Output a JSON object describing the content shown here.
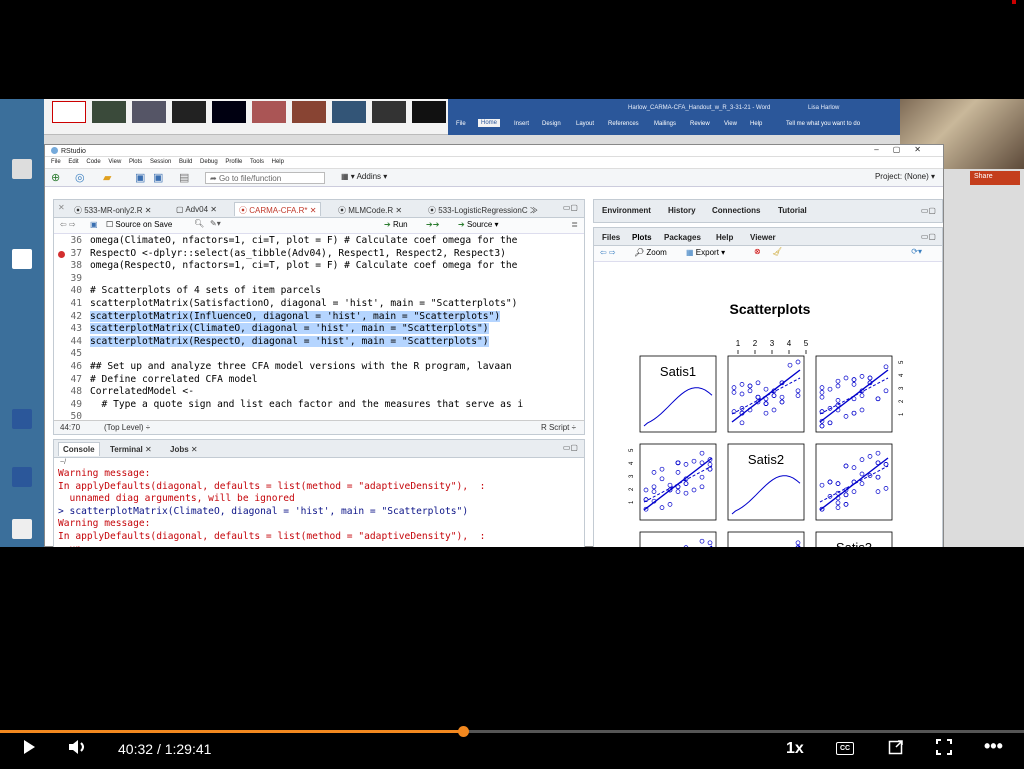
{
  "rstudio": {
    "title": "RStudio",
    "menu": [
      "File",
      "Edit",
      "Code",
      "View",
      "Plots",
      "Session",
      "Build",
      "Debug",
      "Profile",
      "Tools",
      "Help"
    ],
    "goto_placeholder": "Go to file/function",
    "addins_label": "Addins",
    "project_label": "Project: (None)"
  },
  "word": {
    "title": "Harlow_CARMA-CFA_Handout_w_R_3-31-21 - Word",
    "user": "Lisa Harlow",
    "tabs": [
      "File",
      "Home",
      "Insert",
      "Design",
      "Layout",
      "References",
      "Mailings",
      "Review",
      "View",
      "Help",
      "Tell me what you want to do"
    ],
    "share": "Share"
  },
  "source": {
    "tabs": [
      "533-MR-only2.R",
      "Adv04",
      "CARMA-CFA.R*",
      "MLMCode.R",
      "533-LogisticRegressionC"
    ],
    "active_tab": 2,
    "source_on_save": "Source on Save",
    "run_label": "Run",
    "source_label": "Source",
    "lines": [
      {
        "n": "36",
        "text": "omega(ClimateO, nfactors=1, ci=T, plot = F) # Calculate coef omega for the"
      },
      {
        "n": "37",
        "text": "RespectO <-dplyr::select(as_tibble(Adv04), Respect1, Respect2, Respect3)"
      },
      {
        "n": "38",
        "text": "omega(RespectO, nfactors=1, ci=T, plot = F) # Calculate coef omega for the"
      },
      {
        "n": "39",
        "text": ""
      },
      {
        "n": "40",
        "text": "# Scatterplots of 4 sets of item parcels"
      },
      {
        "n": "41",
        "text": "scatterplotMatrix(SatisfactionO, diagonal = 'hist', main = \"Scatterplots\")"
      },
      {
        "n": "42",
        "text": "scatterplotMatrix(InfluenceO, diagonal = 'hist', main = \"Scatterplots\")"
      },
      {
        "n": "43",
        "text": "scatterplotMatrix(ClimateO, diagonal = 'hist', main = \"Scatterplots\")"
      },
      {
        "n": "44",
        "text": "scatterplotMatrix(RespectO, diagonal = 'hist', main = \"Scatterplots\")"
      },
      {
        "n": "45",
        "text": ""
      },
      {
        "n": "46",
        "text": "## Set up and analyze three CFA model versions with the R program, lavaan"
      },
      {
        "n": "47",
        "text": "# Define correlated CFA model"
      },
      {
        "n": "48",
        "text": "CorrelatedModel <-"
      },
      {
        "n": "49",
        "text": "  # Type a quote sign and list each factor and the measures that serve as i"
      },
      {
        "n": "50",
        "text": ""
      }
    ],
    "status_pos": "44:70",
    "status_scope": "(Top Level) ÷",
    "status_type": "R Script ÷"
  },
  "console": {
    "tabs": [
      "Console",
      "Terminal",
      "Jobs"
    ],
    "path": "~/",
    "lines": [
      {
        "kind": "err",
        "text": "Warning message:"
      },
      {
        "kind": "err",
        "text": "In applyDefaults(diagonal, defaults = list(method = \"adaptiveDensity\"),  :"
      },
      {
        "kind": "err",
        "text": "  unnamed diag arguments, will be ignored"
      },
      {
        "kind": "cmd",
        "text": "> scatterplotMatrix(ClimateO, diagonal = 'hist', main = \"Scatterplots\")"
      },
      {
        "kind": "err",
        "text": "Warning message:"
      },
      {
        "kind": "err",
        "text": "In applyDefaults(diagonal, defaults = list(method = \"adaptiveDensity\"),  :"
      },
      {
        "kind": "err",
        "text": "  un"
      }
    ]
  },
  "env_tabs": [
    "Environment",
    "History",
    "Connections",
    "Tutorial"
  ],
  "plot_tabs": [
    "Files",
    "Plots",
    "Packages",
    "Help",
    "Viewer"
  ],
  "plot_tool": {
    "zoom": "Zoom",
    "export": "Export"
  },
  "plot": {
    "title": "Scatterplots",
    "diag_labels": [
      "Satis1",
      "Satis2",
      "Satis3"
    ],
    "top_ticks": [
      "1",
      "2",
      "3",
      "4",
      "5"
    ],
    "right_ticks": [
      "5",
      "4",
      "3",
      "2",
      "1"
    ],
    "left_ticks": [
      "5",
      "4",
      "3",
      "2",
      "1"
    ],
    "point_color": "#0000cc"
  },
  "player": {
    "current_time": "40:32",
    "separator": "/",
    "duration": "1:29:41",
    "progress": 0.4524,
    "speed": "1x",
    "cc": "CC",
    "accent": "#f2881f"
  }
}
